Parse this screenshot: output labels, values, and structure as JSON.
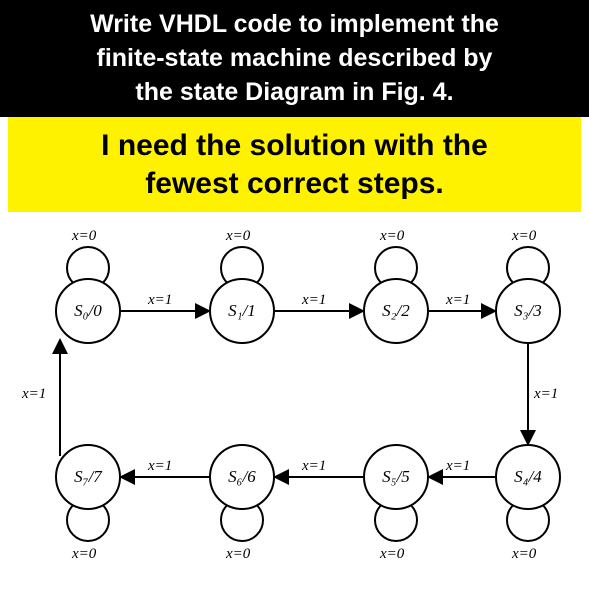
{
  "header_line1": "Write VHDL code to implement the",
  "header_line2": "finite-state machine described by",
  "header_line3": "the state Diagram in Fig. 4.",
  "sub_line1": "I need the solution with the",
  "sub_line2": "fewest correct steps.",
  "diagram": {
    "states": {
      "s0": "S₀/0",
      "s1": "S₁/1",
      "s2": "S₂/2",
      "s3": "S₃/3",
      "s4": "S₄/4",
      "s5": "S₅/5",
      "s6": "S₆/6",
      "s7": "S₇/7"
    },
    "transitions": {
      "loops": {
        "x0": "x=0"
      },
      "links": {
        "s0s1": "x=1",
        "s1s2": "x=1",
        "s2s3": "x=1",
        "s3s4": "x=1",
        "s4s5": "x=1",
        "s5s6": "x=1",
        "s6s7": "x=1",
        "s7s0": "x=1"
      }
    }
  },
  "chart_data": {
    "type": "state-diagram",
    "title": "Fig. 4",
    "states": [
      {
        "name": "S0",
        "output": 0
      },
      {
        "name": "S1",
        "output": 1
      },
      {
        "name": "S2",
        "output": 2
      },
      {
        "name": "S3",
        "output": 3
      },
      {
        "name": "S4",
        "output": 4
      },
      {
        "name": "S5",
        "output": 5
      },
      {
        "name": "S6",
        "output": 6
      },
      {
        "name": "S7",
        "output": 7
      }
    ],
    "transitions": [
      {
        "from": "S0",
        "to": "S0",
        "input": "x=0"
      },
      {
        "from": "S0",
        "to": "S1",
        "input": "x=1"
      },
      {
        "from": "S1",
        "to": "S1",
        "input": "x=0"
      },
      {
        "from": "S1",
        "to": "S2",
        "input": "x=1"
      },
      {
        "from": "S2",
        "to": "S2",
        "input": "x=0"
      },
      {
        "from": "S2",
        "to": "S3",
        "input": "x=1"
      },
      {
        "from": "S3",
        "to": "S3",
        "input": "x=0"
      },
      {
        "from": "S3",
        "to": "S4",
        "input": "x=1"
      },
      {
        "from": "S4",
        "to": "S4",
        "input": "x=0"
      },
      {
        "from": "S4",
        "to": "S5",
        "input": "x=1"
      },
      {
        "from": "S5",
        "to": "S5",
        "input": "x=0"
      },
      {
        "from": "S5",
        "to": "S6",
        "input": "x=1"
      },
      {
        "from": "S6",
        "to": "S6",
        "input": "x=0"
      },
      {
        "from": "S6",
        "to": "S7",
        "input": "x=1"
      },
      {
        "from": "S7",
        "to": "S7",
        "input": "x=0"
      },
      {
        "from": "S7",
        "to": "S0",
        "input": "x=1"
      }
    ]
  }
}
